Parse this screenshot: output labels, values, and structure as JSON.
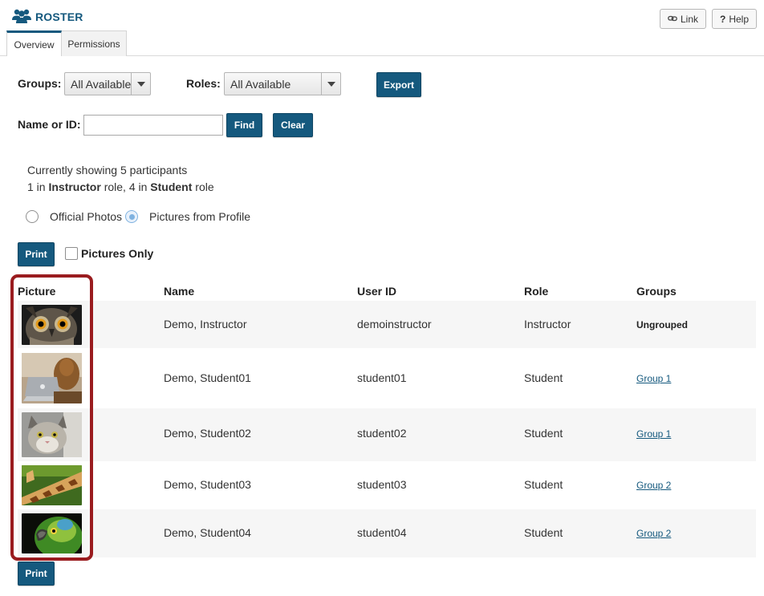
{
  "header": {
    "title": "ROSTER",
    "link_label": "Link",
    "help_label": "Help",
    "help_glyph": "?"
  },
  "tabs": [
    {
      "label": "Overview",
      "active": true
    },
    {
      "label": "Permissions",
      "active": false
    }
  ],
  "filters": {
    "groups_label": "Groups:",
    "groups_value": "All Available",
    "roles_label": "Roles:",
    "roles_value": "All Available",
    "export_label": "Export",
    "name_label": "Name or ID:",
    "name_value": "",
    "find_label": "Find",
    "clear_label": "Clear"
  },
  "summary": {
    "line1": "Currently showing 5 participants",
    "line2_a": "1 in ",
    "line2_b": "Instructor",
    "line2_c": " role, 4 in ",
    "line2_d": "Student",
    "line2_e": " role"
  },
  "photo_options": {
    "official_label": "Official Photos",
    "profile_label": "Pictures from Profile",
    "selected": "profile"
  },
  "print_label": "Print",
  "pictures_only_label": "Pictures Only",
  "columns": [
    "Picture",
    "Name",
    "User ID",
    "Role",
    "Groups"
  ],
  "rows": [
    {
      "name": "Demo, Instructor",
      "user_id": "demoinstructor",
      "role": "Instructor",
      "group": "Ungrouped",
      "picture": "owl-photo"
    },
    {
      "name": "Demo, Student01",
      "user_id": "student01",
      "role": "Student",
      "group": "Group 1",
      "picture": "dog-with-laptop-photo"
    },
    {
      "name": "Demo, Student02",
      "user_id": "student02",
      "role": "Student",
      "group": "Group 1",
      "picture": "cat-photo"
    },
    {
      "name": "Demo, Student03",
      "user_id": "student03",
      "role": "Student",
      "group": "Group 2",
      "picture": "giraffe-photo"
    },
    {
      "name": "Demo, Student04",
      "user_id": "student04",
      "role": "Student",
      "group": "Group 2",
      "picture": "parrot-photo"
    }
  ],
  "colors": {
    "primary": "#15597e",
    "highlight": "#9a1c1f",
    "row_alt": "#f6f6f6"
  }
}
